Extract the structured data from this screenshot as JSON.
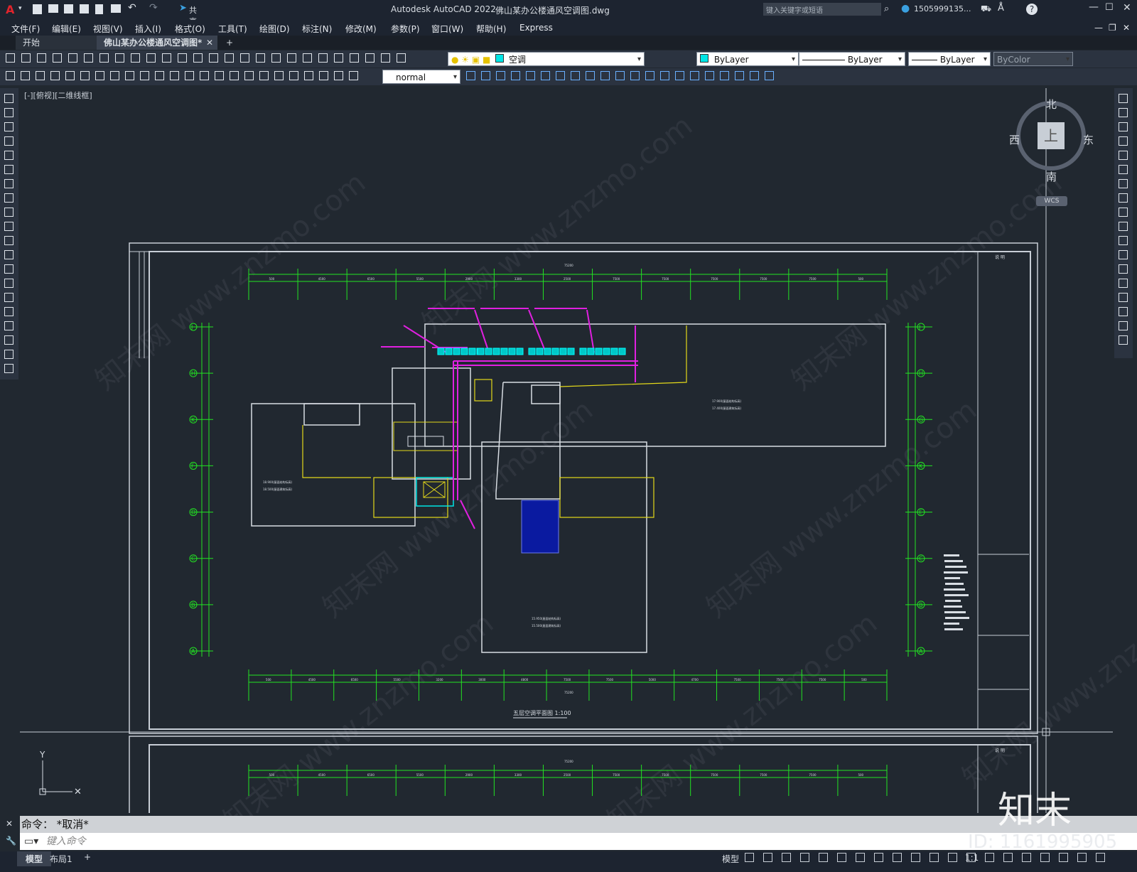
{
  "app": {
    "title": "Autodesk AutoCAD 2022",
    "document": "佛山某办公楼通风空调图.dwg",
    "share": "共享",
    "search_placeholder": "键入关键字或短语",
    "user": "1505999135...",
    "help": "?"
  },
  "menu": [
    "文件(F)",
    "编辑(E)",
    "视图(V)",
    "插入(I)",
    "格式(O)",
    "工具(T)",
    "绘图(D)",
    "标注(N)",
    "修改(M)",
    "参数(P)",
    "窗口(W)",
    "帮助(H)",
    "Express"
  ],
  "tabs": {
    "start": "开始",
    "active": "佛山某办公楼通风空调图*",
    "add": "+"
  },
  "toolbar": {
    "layer": "空调",
    "color": "ByLayer",
    "linetype": "ByLayer",
    "lineweight": "ByLayer",
    "plotstyle": "ByColor",
    "textstyle": "normal"
  },
  "viewport": {
    "label": "[-][俯视][二维线框]"
  },
  "viewcube": {
    "north": "北",
    "south": "南",
    "west": "西",
    "east": "东",
    "top": "上",
    "wcs": "WCS"
  },
  "drawing": {
    "title": "五层空调平面图 1:100",
    "legend_title": "说   明",
    "total_dim": "75200",
    "top_dims": [
      "500",
      "4500",
      "6500",
      "5500",
      "2900",
      "3300",
      "2500",
      "7500",
      "7500",
      "7500",
      "7500",
      "7500",
      "500"
    ],
    "bottom_dims": [
      "500",
      "4500",
      "6500",
      "5500",
      "3200",
      "3000",
      "4800",
      "7500",
      "7500",
      "5000",
      "4700",
      "7500",
      "7500",
      "7500",
      "500"
    ],
    "axes_left": [
      "J",
      "H",
      "K",
      "F",
      "D",
      "C",
      "B",
      "A"
    ],
    "axes_right": [
      "J",
      "H",
      "G",
      "K",
      "E",
      "C",
      "B",
      "A"
    ],
    "elev1": "17.900(屋面结构标高)",
    "elev2": "17.400(屋面建筑标高)",
    "elev3": "18.900(屋面结构标高)",
    "elev4": "18.500(屋面建筑标高)",
    "elev5": "15.950(屋面结构标高)",
    "elev6": "15.500(屋面建筑标高)"
  },
  "command": {
    "history": "命令： *取消*",
    "prompt": "键入命令"
  },
  "status": {
    "model": "模型",
    "layout": "布局1",
    "add": "+",
    "model_btn": "模型",
    "scale": "1:1"
  },
  "brand": {
    "logo": "知末",
    "id": "ID: 1161995905"
  },
  "watermark": "知末网 www.znzmo.com"
}
